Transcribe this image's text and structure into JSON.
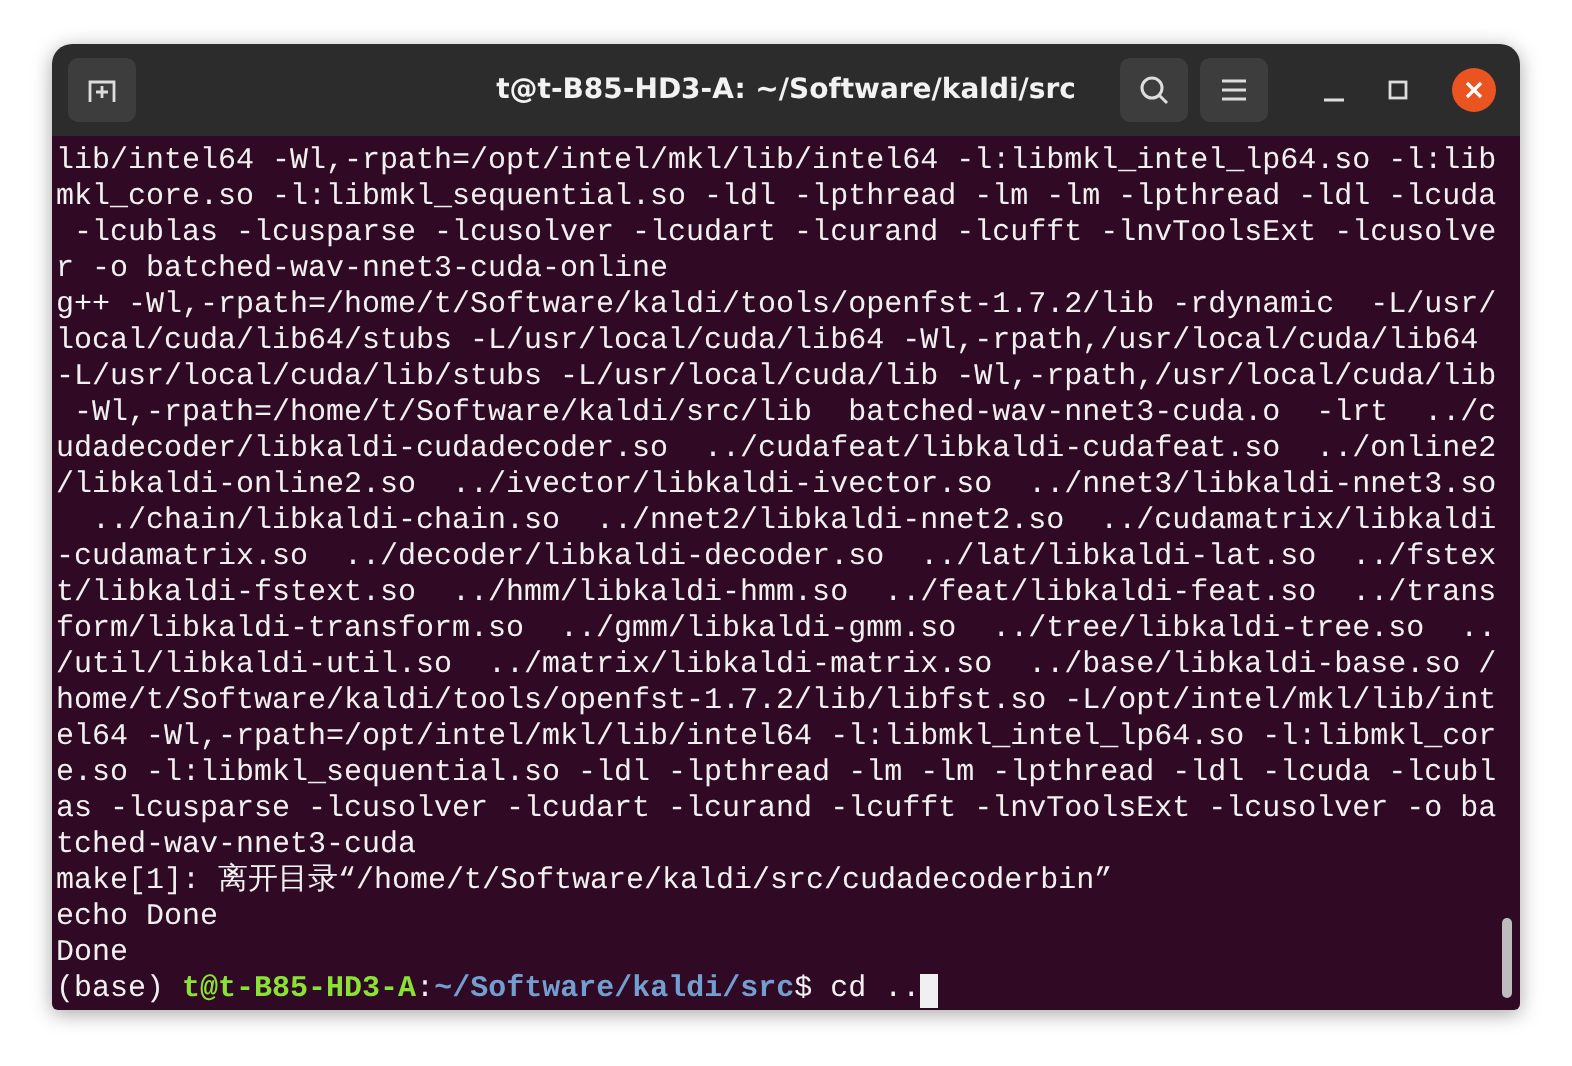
{
  "window": {
    "title": "t@t-B85-HD3-A: ~/Software/kaldi/src"
  },
  "terminal": {
    "lines": [
      {
        "kind": "output",
        "text": "lib/intel64 -Wl,-rpath=/opt/intel/mkl/lib/intel64 -l:libmkl_intel_lp64.so -l:lib"
      },
      {
        "kind": "output",
        "text": "mkl_core.so -l:libmkl_sequential.so -ldl -lpthread -lm -lm -lpthread -ldl -lcuda"
      },
      {
        "kind": "output",
        "text": " -lcublas -lcusparse -lcusolver -lcudart -lcurand -lcufft -lnvToolsExt -lcusolve"
      },
      {
        "kind": "output",
        "text": "r -o batched-wav-nnet3-cuda-online"
      },
      {
        "kind": "output",
        "text": "g++ -Wl,-rpath=/home/t/Software/kaldi/tools/openfst-1.7.2/lib -rdynamic  -L/usr/"
      },
      {
        "kind": "output",
        "text": "local/cuda/lib64/stubs -L/usr/local/cuda/lib64 -Wl,-rpath,/usr/local/cuda/lib64"
      },
      {
        "kind": "output",
        "text": "-L/usr/local/cuda/lib/stubs -L/usr/local/cuda/lib -Wl,-rpath,/usr/local/cuda/lib"
      },
      {
        "kind": "output",
        "text": " -Wl,-rpath=/home/t/Software/kaldi/src/lib  batched-wav-nnet3-cuda.o  -lrt  ../c"
      },
      {
        "kind": "output",
        "text": "udadecoder/libkaldi-cudadecoder.so  ../cudafeat/libkaldi-cudafeat.so  ../online2"
      },
      {
        "kind": "output",
        "text": "/libkaldi-online2.so  ../ivector/libkaldi-ivector.so  ../nnet3/libkaldi-nnet3.so"
      },
      {
        "kind": "output",
        "text": "  ../chain/libkaldi-chain.so  ../nnet2/libkaldi-nnet2.so  ../cudamatrix/libkaldi"
      },
      {
        "kind": "output",
        "text": "-cudamatrix.so  ../decoder/libkaldi-decoder.so  ../lat/libkaldi-lat.so  ../fstex"
      },
      {
        "kind": "output",
        "text": "t/libkaldi-fstext.so  ../hmm/libkaldi-hmm.so  ../feat/libkaldi-feat.so  ../trans"
      },
      {
        "kind": "output",
        "text": "form/libkaldi-transform.so  ../gmm/libkaldi-gmm.so  ../tree/libkaldi-tree.so  .."
      },
      {
        "kind": "output",
        "text": "/util/libkaldi-util.so  ../matrix/libkaldi-matrix.so  ../base/libkaldi-base.so /"
      },
      {
        "kind": "output",
        "text": "home/t/Software/kaldi/tools/openfst-1.7.2/lib/libfst.so -L/opt/intel/mkl/lib/int"
      },
      {
        "kind": "output",
        "text": "el64 -Wl,-rpath=/opt/intel/mkl/lib/intel64 -l:libmkl_intel_lp64.so -l:libmkl_cor"
      },
      {
        "kind": "output",
        "text": "e.so -l:libmkl_sequential.so -ldl -lpthread -lm -lm -lpthread -ldl -lcuda -lcubl"
      },
      {
        "kind": "output",
        "text": "as -lcusparse -lcusolver -lcudart -lcurand -lcufft -lnvToolsExt -lcusolver -o ba"
      },
      {
        "kind": "output",
        "text": "tched-wav-nnet3-cuda"
      },
      {
        "kind": "output",
        "text": "make[1]: 离开目录“/home/t/Software/kaldi/src/cudadecoderbin”"
      },
      {
        "kind": "output",
        "text": "echo Done"
      },
      {
        "kind": "output",
        "text": "Done"
      },
      {
        "kind": "prompt",
        "env": "(base)",
        "user_host": "t@t-B85-HD3-A",
        "separator": ":",
        "path": "~/Software/kaldi/src",
        "symbol": "$",
        "command": "cd .."
      }
    ]
  }
}
